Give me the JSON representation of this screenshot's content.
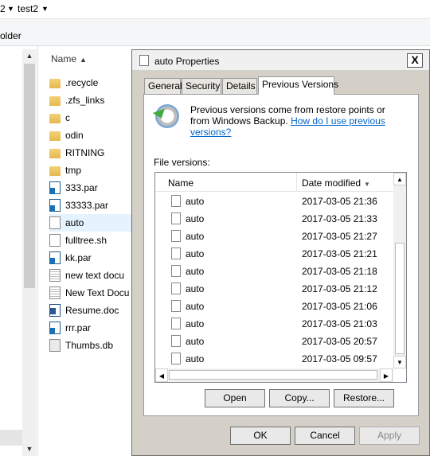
{
  "explorer": {
    "breadcrumb_prev": "2",
    "breadcrumb_current": "test2",
    "toolbar_partial": "older",
    "column_name": "Name",
    "files": [
      {
        "name": ".recycle",
        "icon": "folder-icon"
      },
      {
        "name": ".zfs_links",
        "icon": "folder-icon"
      },
      {
        "name": "c",
        "icon": "folder-icon"
      },
      {
        "name": "odin",
        "icon": "folder-icon"
      },
      {
        "name": "RITNING",
        "icon": "folder-icon"
      },
      {
        "name": "tmp",
        "icon": "folder-icon"
      },
      {
        "name": "333.par",
        "icon": "par-file-icon"
      },
      {
        "name": "33333.par",
        "icon": "par-file-icon"
      },
      {
        "name": "auto",
        "icon": "file-icon"
      },
      {
        "name": "fulltree.sh",
        "icon": "file-icon"
      },
      {
        "name": "kk.par",
        "icon": "par-file-icon"
      },
      {
        "name": "new text docu",
        "icon": "text-file-icon"
      },
      {
        "name": "New Text Docu",
        "icon": "text-file-icon"
      },
      {
        "name": "Resume.doc",
        "icon": "word-doc-icon"
      },
      {
        "name": "rrr.par",
        "icon": "par-file-icon"
      },
      {
        "name": "Thumbs.db",
        "icon": "db-file-icon"
      }
    ]
  },
  "dialog": {
    "title": "auto Properties",
    "close_label": "X",
    "tabs": [
      "General",
      "Security",
      "Details",
      "Previous Versions"
    ],
    "active_tab": "Previous Versions",
    "info_text": "Previous versions come from restore points or from Windows Backup.",
    "info_link": "How do I use previous versions?",
    "file_versions_label": "File versions:",
    "columns": {
      "name": "Name",
      "date": "Date modified"
    },
    "versions": [
      {
        "name": "auto",
        "date": "2017-03-05 21:36"
      },
      {
        "name": "auto",
        "date": "2017-03-05 21:33"
      },
      {
        "name": "auto",
        "date": "2017-03-05 21:27"
      },
      {
        "name": "auto",
        "date": "2017-03-05 21:21"
      },
      {
        "name": "auto",
        "date": "2017-03-05 21:18"
      },
      {
        "name": "auto",
        "date": "2017-03-05 21:12"
      },
      {
        "name": "auto",
        "date": "2017-03-05 21:06"
      },
      {
        "name": "auto",
        "date": "2017-03-05 21:03"
      },
      {
        "name": "auto",
        "date": "2017-03-05 20:57"
      },
      {
        "name": "auto",
        "date": "2017-03-05 09:57"
      }
    ],
    "panel_buttons": {
      "open": "Open",
      "copy": "Copy...",
      "restore": "Restore..."
    },
    "buttons": {
      "ok": "OK",
      "cancel": "Cancel",
      "apply": "Apply"
    }
  }
}
